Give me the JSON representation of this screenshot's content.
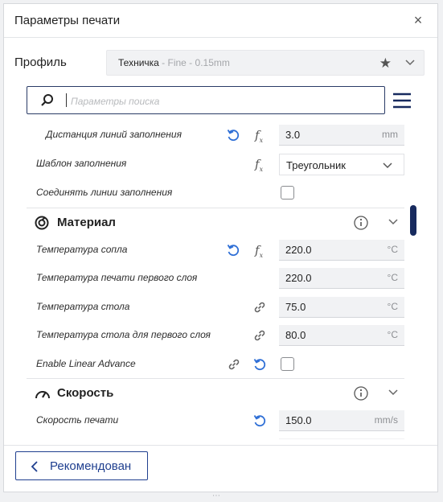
{
  "window": {
    "title": "Параметры печати",
    "close": "×"
  },
  "profile": {
    "label": "Профиль",
    "name": "Техничка",
    "detail": " - Fine - 0.15mm"
  },
  "search": {
    "placeholder": "Параметры поиска",
    "value": ""
  },
  "settings": [
    {
      "label": "Дистанция линий заполнения",
      "value": "3.0",
      "unit": "mm"
    },
    {
      "label": "Шаблон заполнения",
      "value": "Треугольник"
    },
    {
      "label": "Соединять линии заполнения",
      "checked": false
    }
  ],
  "material": {
    "title": "Материал",
    "rows": [
      {
        "label": "Температура сопла",
        "value": "220.0",
        "unit": "°C"
      },
      {
        "label": "Температура печати первого слоя",
        "value": "220.0",
        "unit": "°C"
      },
      {
        "label": "Температура стола",
        "value": "75.0",
        "unit": "°C"
      },
      {
        "label": "Температура стола для первого слоя",
        "value": "80.0",
        "unit": "°C"
      },
      {
        "label": "Enable Linear Advance",
        "checked": false
      }
    ]
  },
  "speed": {
    "title": "Скорость",
    "rows": [
      {
        "label": "Скорость печати",
        "value": "150.0",
        "unit": "mm/s"
      }
    ]
  },
  "footer": {
    "recommended_label": "Рекомендован"
  },
  "colors": {
    "accent": "#1f3f8f",
    "icon_blue": "#2f6fd6",
    "scroll": "#172a5e"
  }
}
